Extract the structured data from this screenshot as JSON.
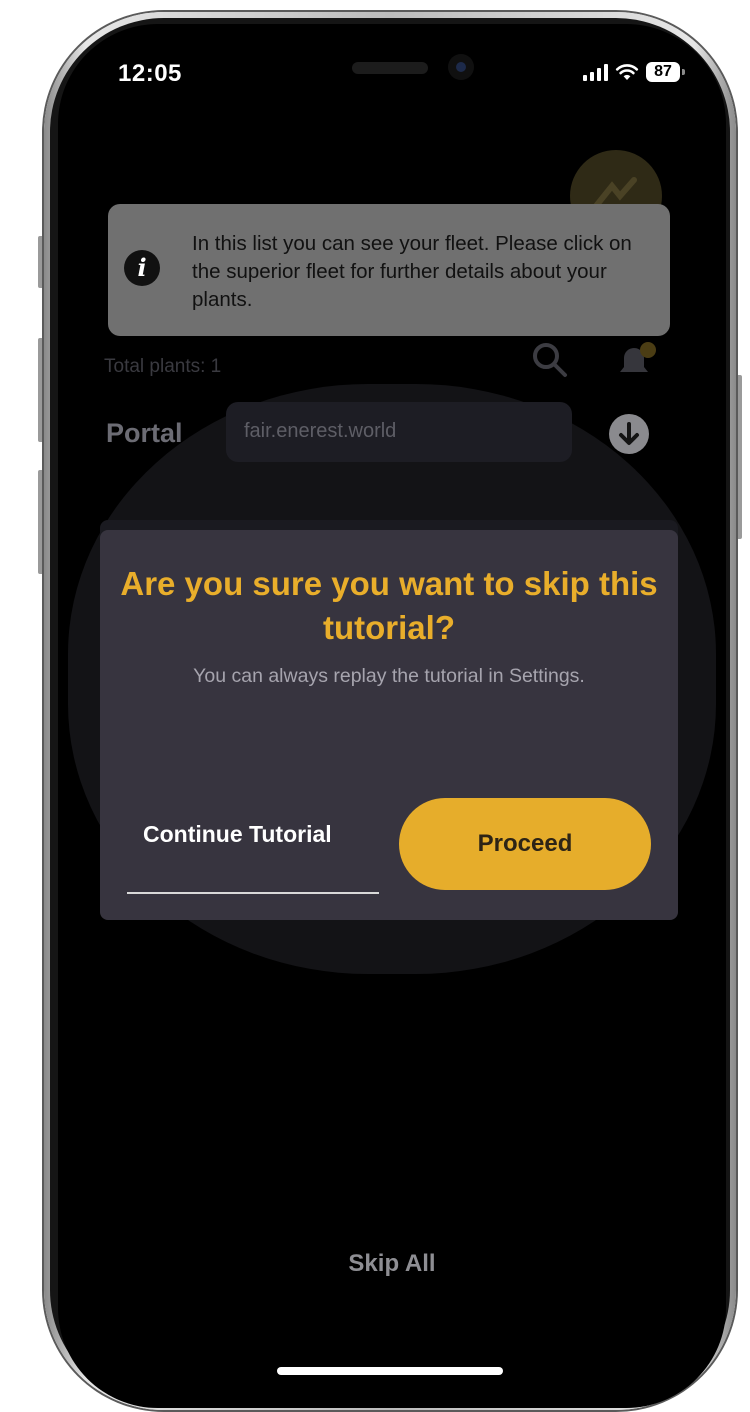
{
  "status_bar": {
    "time": "12:05",
    "battery": "87",
    "signal_icon": "cellular-signal-icon",
    "wifi_icon": "wifi-icon"
  },
  "background": {
    "total_plants": "Total plants: 1",
    "portal_label": "Portal",
    "portal_value": "fair.enerest.world"
  },
  "tooltip": {
    "icon": "info-icon",
    "text": "In this list you can see your fleet. Please click on the superior fleet for further details about your plants."
  },
  "dialog": {
    "title": "Are you sure you want to skip this tutorial?",
    "message": "You can always replay the tutorial in Settings.",
    "continue_label": "Continue Tutorial",
    "proceed_label": "Proceed"
  },
  "footer": {
    "skip_all_label": "Skip All"
  },
  "colors": {
    "accent": "#e6ad2b",
    "dialog_bg": "#37343f",
    "tooltip_bg": "#707070",
    "screen_bg": "#000000"
  }
}
